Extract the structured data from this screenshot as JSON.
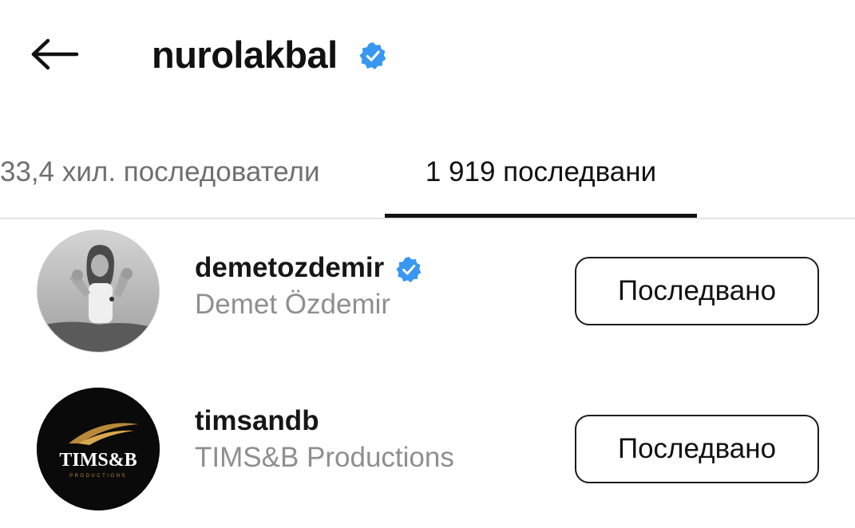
{
  "header": {
    "back_icon": "arrow-left-icon",
    "title": "nurolakbal",
    "verified_icon": "verified-badge-icon"
  },
  "tabs": [
    {
      "label": "33,4 хил. последователи",
      "active": false
    },
    {
      "label": "1 919 последвани",
      "active": true
    }
  ],
  "colors": {
    "verified": "#3897f0",
    "text_primary": "#111111",
    "text_secondary": "#8f8f8f",
    "divider": "#e4e4e4"
  },
  "list": [
    {
      "username": "demetozdemir",
      "full_name": "Demet Özdemir",
      "verified": true,
      "button_label": "Последвано",
      "avatar_icon": "profile-photo"
    },
    {
      "username": "timsandb",
      "full_name": "TIMS&B Productions",
      "verified": false,
      "button_label": "Последвано",
      "avatar_logo_text": "TIMS&B",
      "avatar_logo_subtext": "PRODUCTIONS"
    }
  ]
}
